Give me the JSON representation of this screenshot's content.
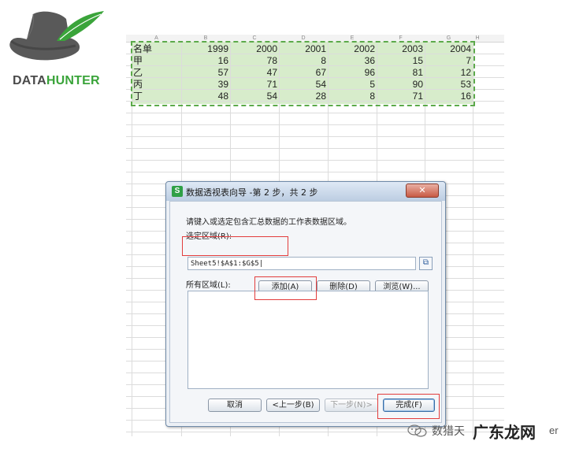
{
  "logo": {
    "text_part1": "DATA",
    "text_part2": "HUNTER",
    "icon_name": "hat-with-feather-icon"
  },
  "sheet": {
    "column_headers": [
      "A",
      "B",
      "C",
      "D",
      "E",
      "F",
      "G",
      "H"
    ],
    "header_row": [
      "名单",
      "1999",
      "2000",
      "2001",
      "2002",
      "2003",
      "2004"
    ],
    "rows": [
      [
        "甲",
        "16",
        "78",
        "8",
        "36",
        "15",
        "7"
      ],
      [
        "乙",
        "57",
        "47",
        "67",
        "96",
        "81",
        "12"
      ],
      [
        "丙",
        "39",
        "71",
        "54",
        "5",
        "90",
        "53"
      ],
      [
        "丁",
        "48",
        "54",
        "28",
        "8",
        "71",
        "16"
      ]
    ],
    "selection_color": "#d7eccb"
  },
  "dialog": {
    "app_icon": "S",
    "title": "数据透视表向导 -第 2 步，共 2 步",
    "close_label": "✕",
    "prompt": "请键入或选定包含汇总数据的工作表数据区域。",
    "range_label": "选定区域(R):",
    "range_value": "Sheet5!$A$1:$G$5|",
    "collapse_icon": "range-select-icon",
    "add_label": "添加(A)",
    "delete_label": "删除(D)",
    "browse_label": "浏览(W)...",
    "all_ranges_label": "所有区域(L):",
    "cancel_label": "取消",
    "prev_label": "<上一步(B)",
    "next_label": "下一步(N)>",
    "finish_label": "完成(F)"
  },
  "watermark": {
    "text": "数猎天",
    "text2": "er",
    "brand": "广东龙网"
  },
  "colors": {
    "highlight_red": "#e23d3d",
    "logo_green": "#3aa43a",
    "selection_border": "#5caa4a"
  }
}
